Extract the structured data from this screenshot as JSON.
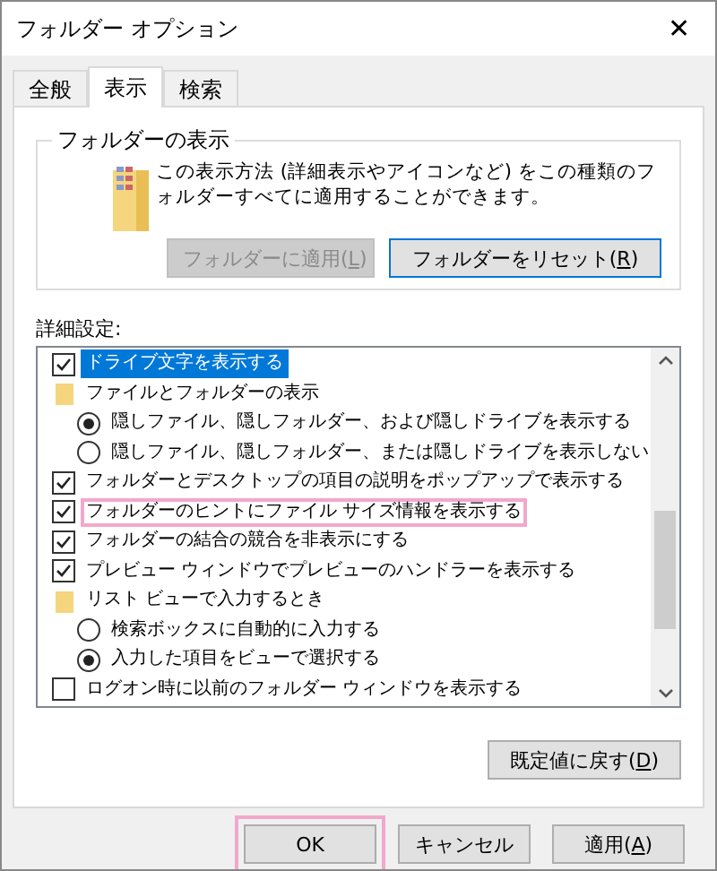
{
  "window": {
    "title": "フォルダー オプション",
    "close": "✕"
  },
  "tabs": [
    {
      "label": "全般",
      "selected": false
    },
    {
      "label": "表示",
      "selected": true
    },
    {
      "label": "検索",
      "selected": false
    }
  ],
  "folder_views": {
    "title": "フォルダーの表示",
    "description": "この表示方法 (詳細表示やアイコンなど) をこの種類のフォルダーすべてに適用することができます。",
    "buttons": [
      {
        "label": "フォルダーに適用(L)",
        "disabled": true
      },
      {
        "label": "フォルダーをリセット(R)",
        "disabled": false
      }
    ]
  },
  "advanced": {
    "label": "詳細設定:",
    "items": [
      {
        "kind": "checkbox",
        "label": "ドライブ文字を表示する",
        "checked": true,
        "selected": true,
        "annotated": false
      },
      {
        "kind": "folder",
        "label": "ファイルとフォルダーの表示",
        "selected": false,
        "annotated": false,
        "children": [
          {
            "kind": "radio",
            "label": "隠しファイル、隠しフォルダー、および隠しドライブを表示する",
            "checked": true,
            "selected": false,
            "annotated": false
          },
          {
            "kind": "radio",
            "label": "隠しファイル、隠しフォルダー、または隠しドライブを表示しない",
            "checked": false,
            "selected": false,
            "annotated": false
          }
        ]
      },
      {
        "kind": "checkbox",
        "label": "フォルダーとデスクトップの項目の説明をポップアップで表示する",
        "checked": true,
        "selected": false,
        "annotated": false
      },
      {
        "kind": "checkbox",
        "label": "フォルダーのヒントにファイル サイズ情報を表示する",
        "checked": true,
        "selected": false,
        "annotated": true
      },
      {
        "kind": "checkbox",
        "label": "フォルダーの結合の競合を非表示にする",
        "checked": true,
        "selected": false,
        "annotated": false
      },
      {
        "kind": "checkbox",
        "label": "プレビュー ウィンドウでプレビューのハンドラーを表示する",
        "checked": true,
        "selected": false,
        "annotated": false
      },
      {
        "kind": "folder",
        "label": "リスト ビューで入力するとき",
        "selected": false,
        "annotated": false,
        "children": [
          {
            "kind": "radio",
            "label": "検索ボックスに自動的に入力する",
            "checked": false,
            "selected": false,
            "annotated": false
          },
          {
            "kind": "radio",
            "label": "入力した項目をビューで選択する",
            "checked": true,
            "selected": false,
            "annotated": false
          }
        ]
      },
      {
        "kind": "checkbox",
        "label": "ログオン時に以前のフォルダー ウィンドウを表示する",
        "checked": false,
        "selected": false,
        "annotated": false
      }
    ],
    "restore_button": "既定値に戻す(D)"
  },
  "footer_buttons": [
    {
      "label": "OK",
      "annotated": true
    },
    {
      "label": "キャンセル",
      "annotated": false
    },
    {
      "label": "適用(A)",
      "annotated": false
    }
  ]
}
